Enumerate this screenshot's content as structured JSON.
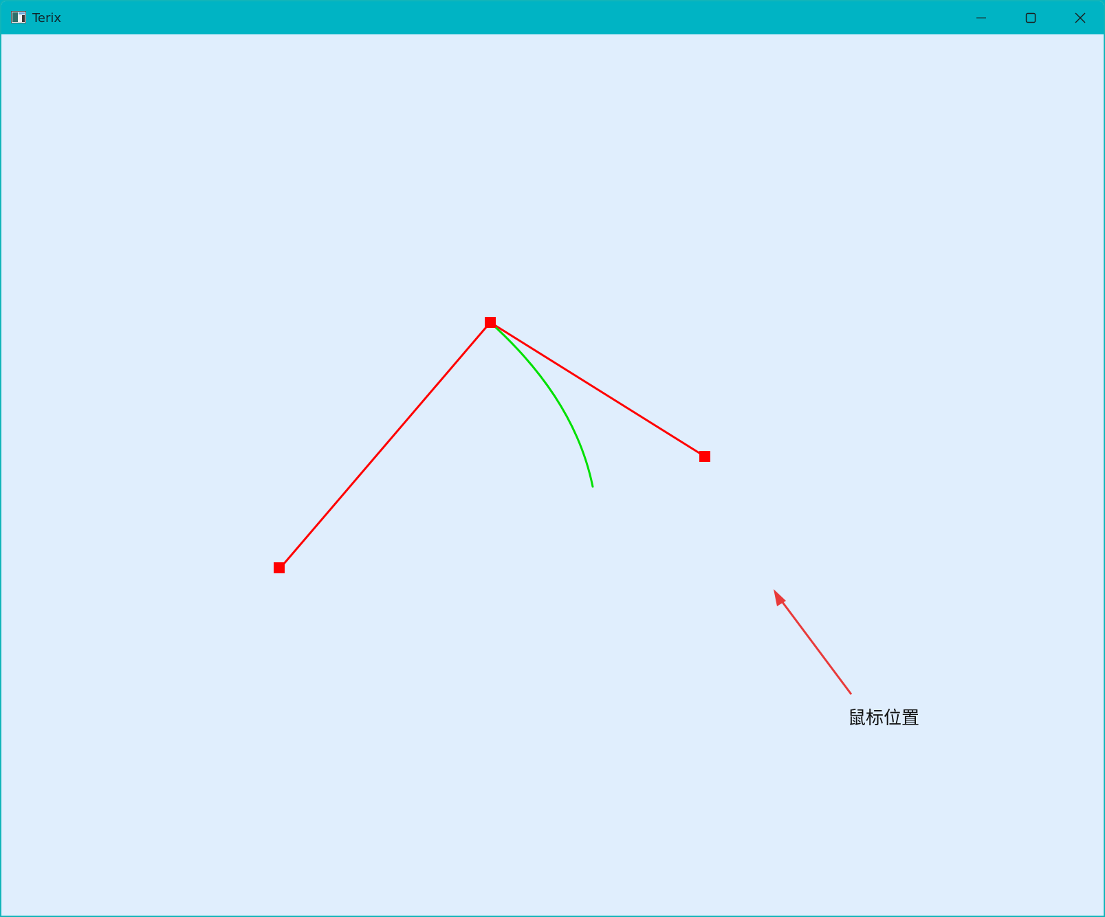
{
  "window": {
    "title": "Terix",
    "titlebar_color": "#00b4c4",
    "canvas_color": "#e0eefd"
  },
  "controls": {
    "minimize_icon": "minimize-icon",
    "maximize_icon": "maximize-icon",
    "close_icon": "close-icon"
  },
  "drawing": {
    "segment_color": "#ff0000",
    "curve_color": "#00e000",
    "handle_color": "#ff0000"
  },
  "annotation": {
    "label": "鼠标位置",
    "arrow_color": "#e83a3a"
  }
}
